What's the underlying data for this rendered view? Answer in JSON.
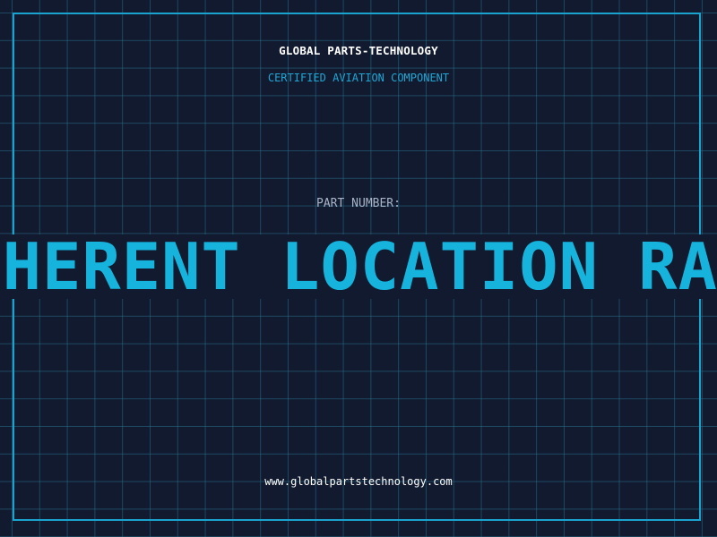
{
  "header": {
    "company": "GLOBAL PARTS-TECHNOLOGY",
    "tagline": "CERTIFIED AVIATION COMPONENT"
  },
  "part": {
    "label": "PART NUMBER:",
    "scrolling_text": "COHERENT LOCATION RADAR"
  },
  "footer": {
    "url": "www.globalpartstechnology.com"
  },
  "colors": {
    "background": "#111a2e",
    "grid": "#286e8c",
    "accent": "#16b3dd",
    "frame": "#1ba3cf",
    "label": "#a8b4c8",
    "text": "#ffffff"
  }
}
